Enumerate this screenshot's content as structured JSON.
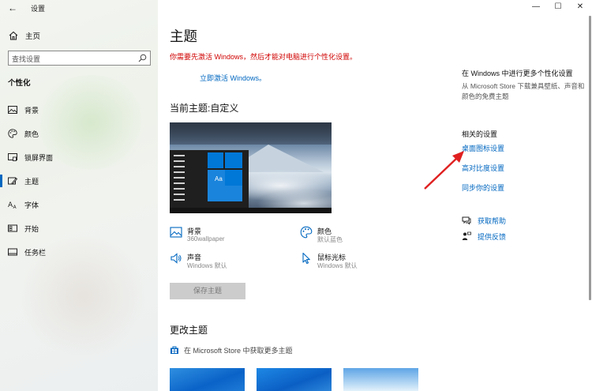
{
  "window": {
    "app_title": "设置",
    "back_icon": "back-arrow-icon",
    "minimize": "—",
    "maximize": "☐",
    "close": "✕"
  },
  "sidebar": {
    "home_label": "主页",
    "search_placeholder": "查找设置",
    "section": "个性化",
    "items": [
      {
        "label": "背景",
        "icon": "image-icon"
      },
      {
        "label": "颜色",
        "icon": "palette-icon"
      },
      {
        "label": "锁屏界面",
        "icon": "lock-screen-icon"
      },
      {
        "label": "主题",
        "icon": "theme-brush-icon",
        "selected": true
      },
      {
        "label": "字体",
        "icon": "font-icon"
      },
      {
        "label": "开始",
        "icon": "start-icon"
      },
      {
        "label": "任务栏",
        "icon": "taskbar-icon"
      }
    ]
  },
  "main": {
    "title": "主题",
    "activation_warning": "你需要先激活 Windows，然后才能对电脑进行个性化设置。",
    "activate_link": "立即激活 Windows。",
    "current_theme": "当前主题:自定义",
    "preview_tile_label": "Aa",
    "properties": [
      {
        "name": "背景",
        "value": "360wallpaper",
        "icon": "image-icon"
      },
      {
        "name": "颜色",
        "value": "默认蓝色",
        "icon": "palette-icon"
      },
      {
        "name": "声音",
        "value": "Windows 默认",
        "icon": "speaker-icon"
      },
      {
        "name": "鼠标光标",
        "value": "Windows 默认",
        "icon": "cursor-icon"
      }
    ],
    "save_theme": "保存主题",
    "change_theme": "更改主题",
    "store_link": "在 Microsoft Store 中获取更多主题"
  },
  "right": {
    "more_heading": "在 Windows 中进行更多个性化设置",
    "more_desc": "从 Microsoft Store 下载兼具壁纸、声音和颜色的免费主题",
    "related_heading": "相关的设置",
    "links": [
      "桌面图标设置",
      "高对比度设置",
      "同步你的设置"
    ],
    "help": "获取帮助",
    "feedback": "提供反馈"
  },
  "colors": {
    "accent": "#0067c0",
    "warning": "#d00000",
    "annotation_arrow": "#e02020"
  }
}
